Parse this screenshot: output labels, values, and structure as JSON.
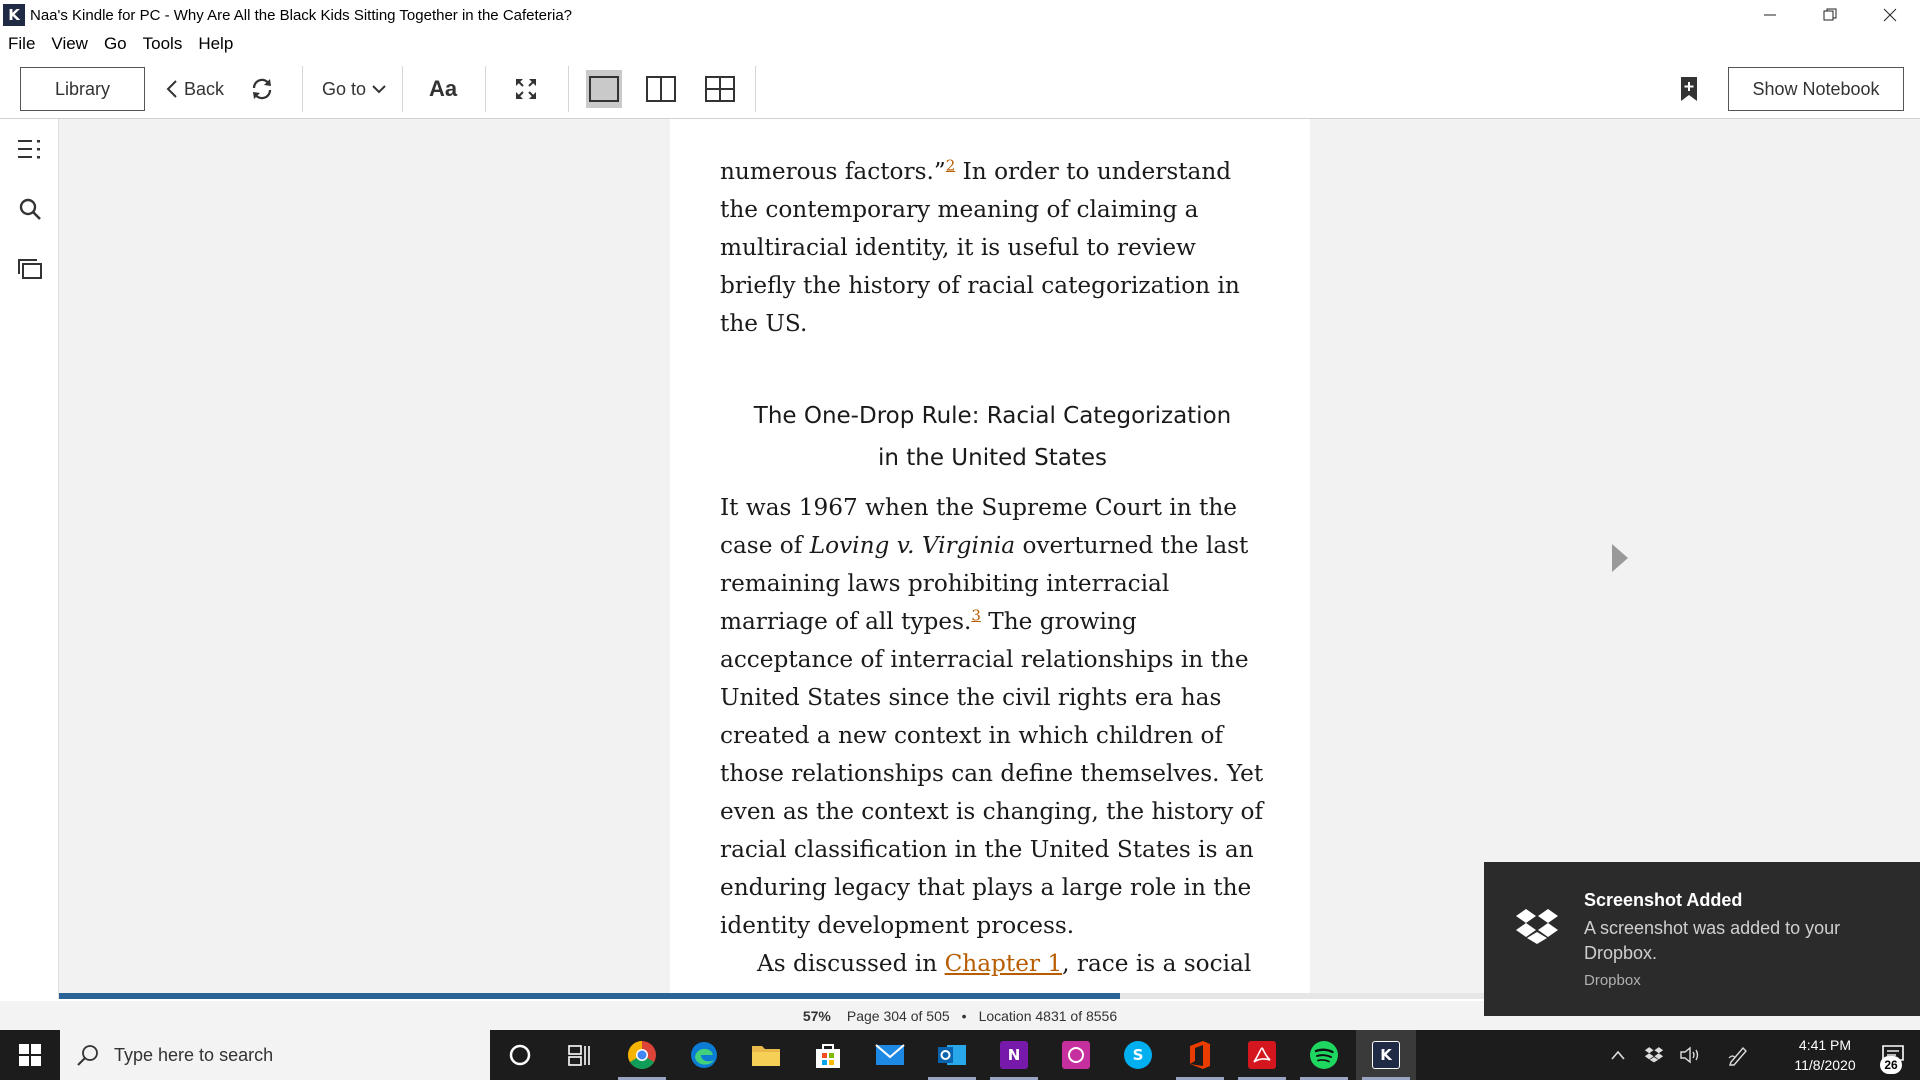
{
  "window": {
    "title": "Naa's Kindle for PC - Why Are All the Black Kids Sitting Together in the Cafeteria?",
    "app_icon_glyph": "K"
  },
  "menu": [
    "File",
    "View",
    "Go",
    "Tools",
    "Help"
  ],
  "toolbar": {
    "library": "Library",
    "back": "Back",
    "goto": "Go to",
    "font": "Aa",
    "show_notebook": "Show Notebook"
  },
  "book": {
    "para1_a": "numerous factors.”",
    "para1_fn": "2",
    "para1_b": " In order to understand the contemporary meaning of claiming a multiracial identity, it is useful to review briefly the history of racial categorization in the US.",
    "heading_line1": "The One-Drop Rule: Racial Categorization",
    "heading_line2": "in the United States",
    "para2_a": "It was 1967 when the Supreme Court in the case of ",
    "para2_italic": "Loving v. Virginia",
    "para2_b": " overturned the last remaining laws prohibiting interracial marriage of all types.",
    "para2_fn": "3",
    "para2_c": " The growing acceptance of interracial relation­ships in the United States since the civil rights era has created a new context in which children of those relationships can define themselves. Yet even as the context is changing, the history of racial clas­sification in the United States is an enduring legacy that plays a large role in the identity development process.",
    "para3_a": "As discussed in ",
    "para3_link": "Chapter 1",
    "para3_b": ", race is a social"
  },
  "progress": {
    "fraction": 0.57,
    "percent_label": "57%",
    "page_label": "Page 304 of 505",
    "dot": "•",
    "location_label": "Location 4831 of 8556"
  },
  "toast": {
    "title": "Screenshot Added",
    "body": "A screenshot was added to your Dropbox.",
    "source": "Dropbox",
    "icon": "dropbox-icon"
  },
  "taskbar": {
    "search_placeholder": "Type here to search",
    "apps": [
      "cortana-icon",
      "task-view-icon",
      "chrome-icon",
      "edge-icon",
      "file-explorer-icon",
      "store-icon",
      "mail-icon",
      "outlook-icon",
      "onenote-icon",
      "whatsapp-icon",
      "skype-icon",
      "office-icon",
      "acrobat-icon",
      "spotify-icon",
      "kindle-icon"
    ],
    "onenote_glyph": "N",
    "skype_glyph": "S",
    "kindle_glyph": "K",
    "time": "4:41 PM",
    "date": "11/8/2020",
    "notification_count": "26"
  },
  "colors": {
    "link": "#b85c00",
    "progress": "#2a6496",
    "toast_bg": "#2b2b2b",
    "taskbar_bg": "#1c1c1c"
  }
}
